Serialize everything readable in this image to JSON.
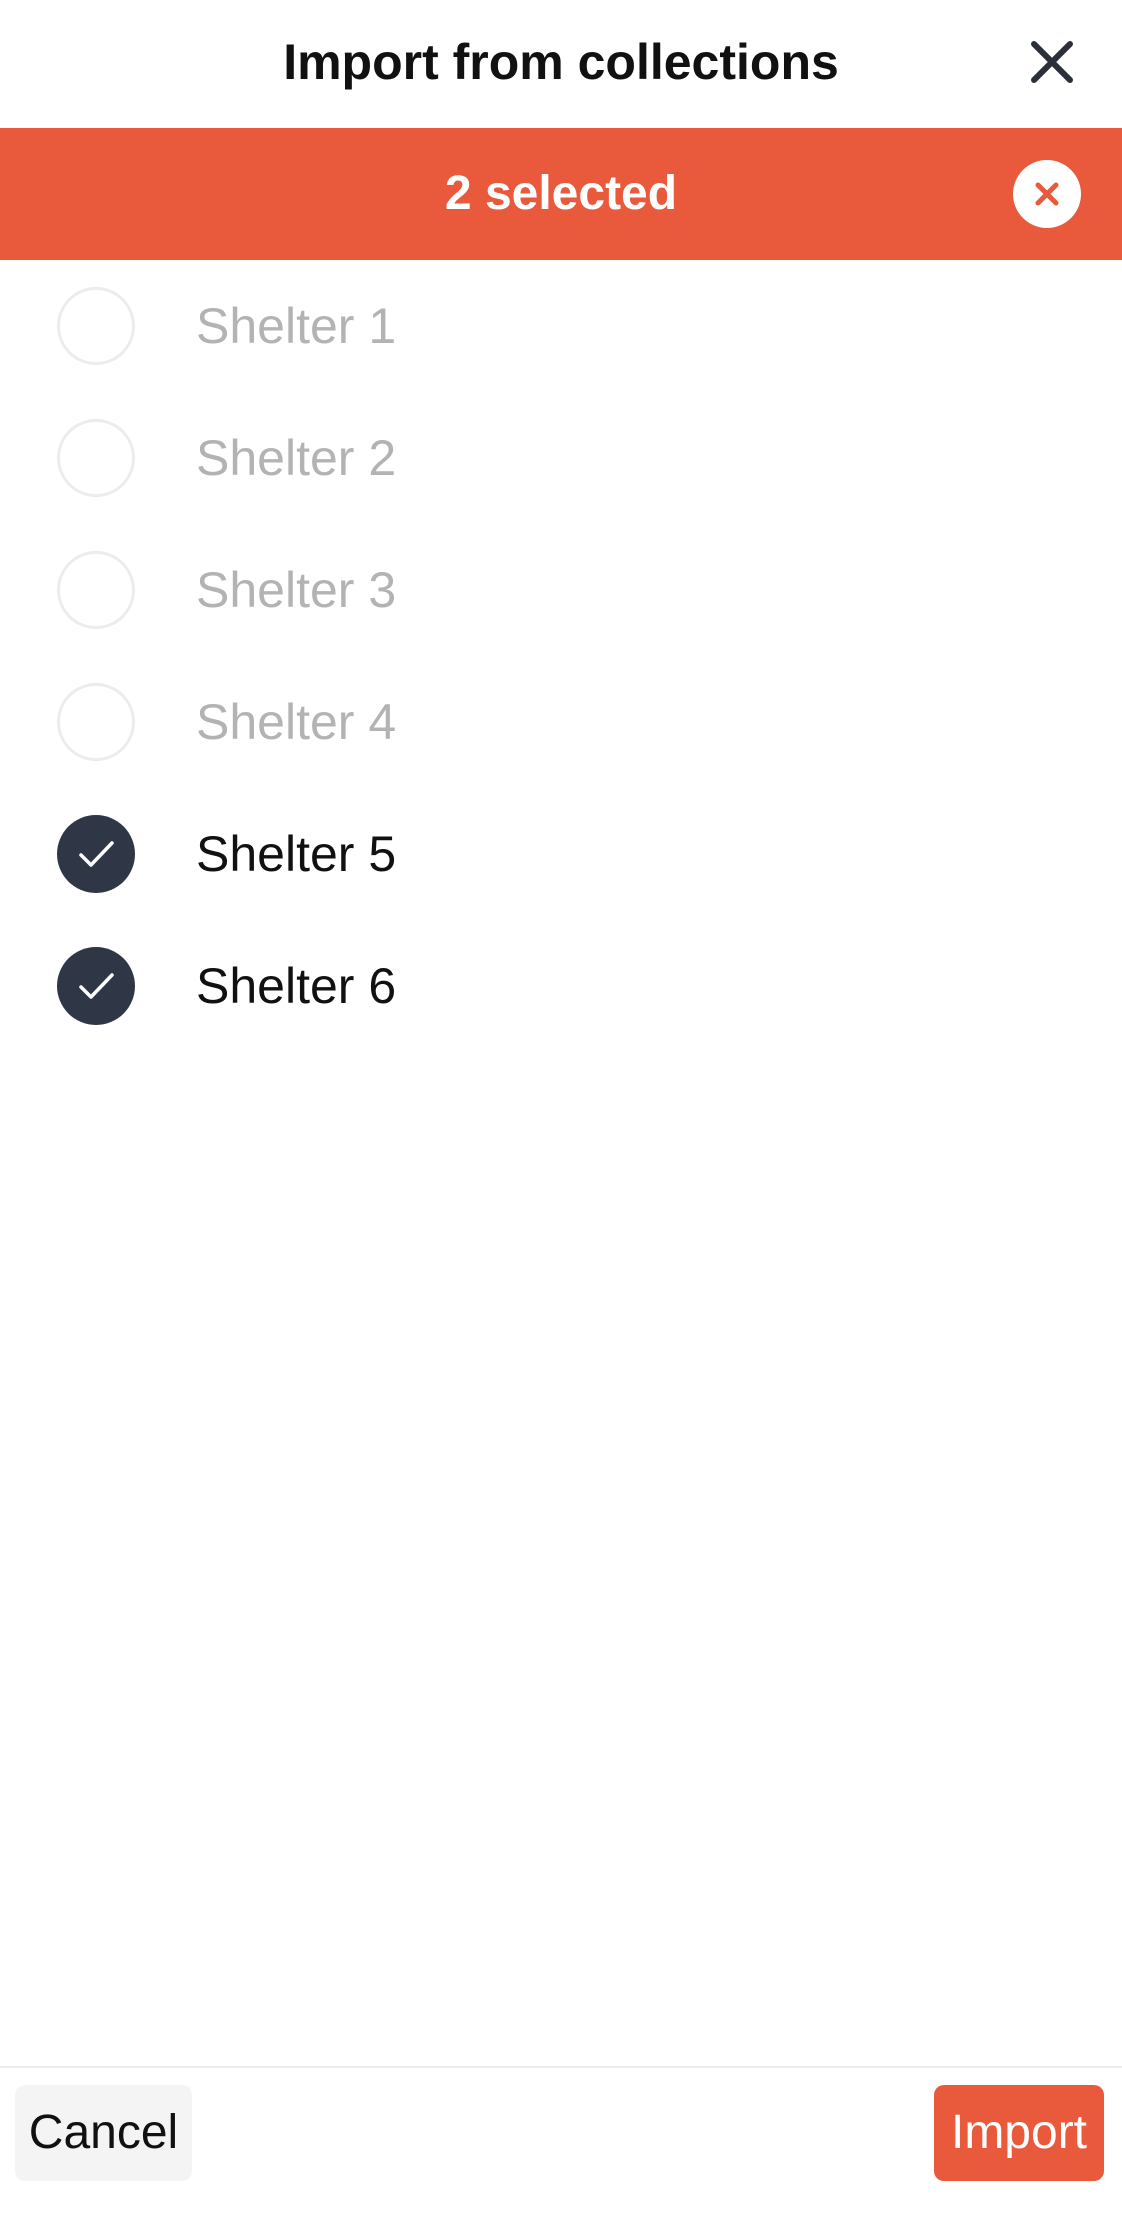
{
  "header": {
    "title": "Import from collections",
    "close_icon": "close-icon"
  },
  "selection_bar": {
    "text": "2 selected",
    "clear_icon": "clear-selection-icon",
    "color": "#e85a3b"
  },
  "collections": [
    {
      "label": "Shelter 1",
      "selected": false
    },
    {
      "label": "Shelter 2",
      "selected": false
    },
    {
      "label": "Shelter 3",
      "selected": false
    },
    {
      "label": "Shelter 4",
      "selected": false
    },
    {
      "label": "Shelter 5",
      "selected": true
    },
    {
      "label": "Shelter 6",
      "selected": true
    }
  ],
  "footer": {
    "cancel_label": "Cancel",
    "import_label": "Import"
  },
  "colors": {
    "accent": "#e85a3b",
    "checked": "#2f3646",
    "unchecked_text": "#b3b3b3"
  }
}
